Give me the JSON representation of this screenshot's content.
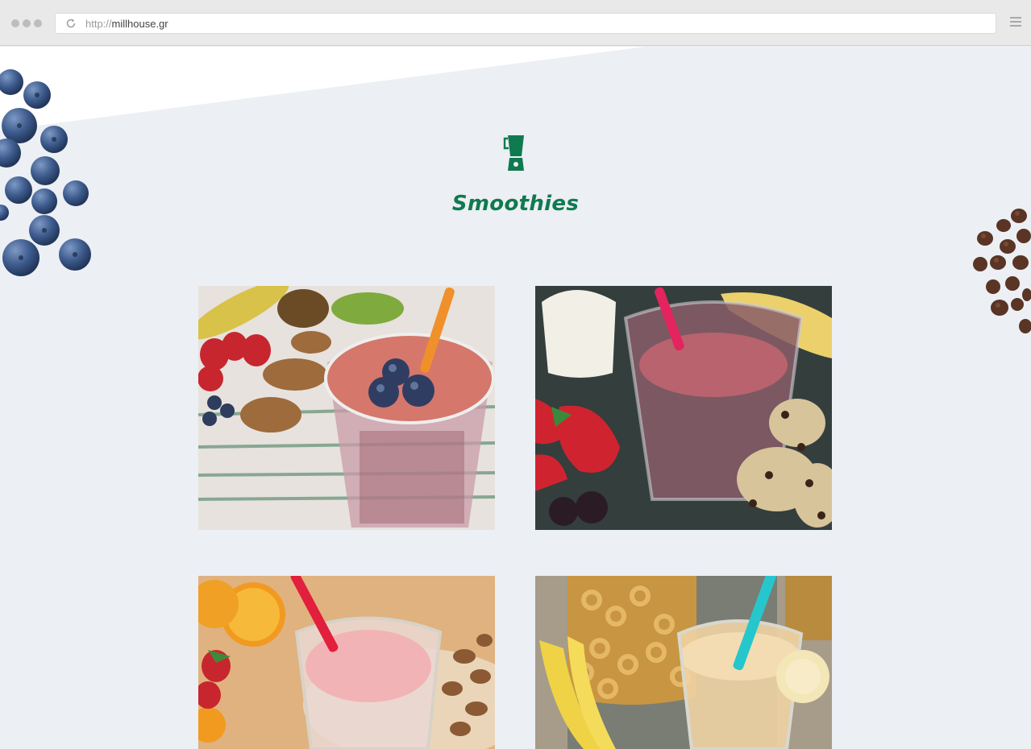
{
  "browser": {
    "url_protocol": "http://",
    "url_host": "millhouse.gr"
  },
  "section": {
    "icon": "blender-icon",
    "title": "Smoothies"
  },
  "colors": {
    "accent": "#0f7a4e",
    "page_bg": "#eceff4"
  },
  "gallery": [
    {
      "name": "smoothie-photo-1",
      "description_icon": "blueberry-smoothie-image"
    },
    {
      "name": "smoothie-photo-2",
      "description_icon": "berry-smoothie-image"
    },
    {
      "name": "smoothie-photo-3",
      "description_icon": "strawberry-orange-smoothie-image"
    },
    {
      "name": "smoothie-photo-4",
      "description_icon": "banana-smoothie-image"
    }
  ]
}
